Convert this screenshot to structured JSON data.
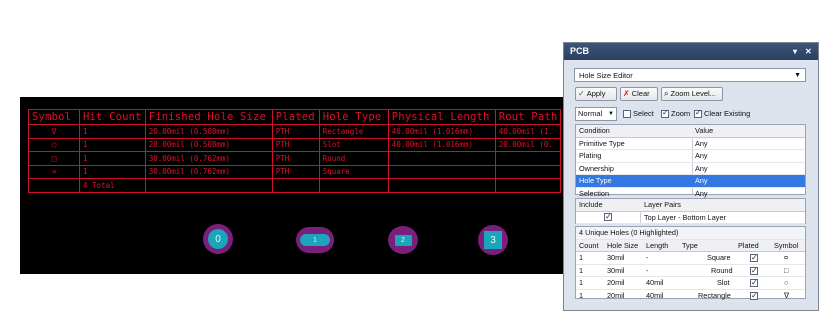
{
  "drill_table": {
    "headers": [
      "Symbol",
      "Hit Count",
      "Finished Hole Size",
      "Plated",
      "Hole Type",
      "Physical Length",
      "Rout Path"
    ],
    "rows": [
      {
        "symbol": "∇",
        "hits": "1",
        "size": "20.00mil (0.508mm)",
        "plated": "PTH",
        "type": "Rectangle",
        "length": "40.00mil (1.016mm)",
        "rout": "40.00mil (1."
      },
      {
        "symbol": "○",
        "hits": "1",
        "size": "20.00mil (0.508mm)",
        "plated": "PTH",
        "type": "Slot",
        "length": "40.00mil (1.016mm)",
        "rout": "20.00mil (0."
      },
      {
        "symbol": "□",
        "hits": "1",
        "size": "30.00mil (0.762mm)",
        "plated": "PTH",
        "type": "Round",
        "length": "",
        "rout": ""
      },
      {
        "symbol": "¤",
        "hits": "1",
        "size": "30.00mil (0.762mm)",
        "plated": "PTH",
        "type": "Square",
        "length": "",
        "rout": ""
      }
    ],
    "total": "4 Total"
  },
  "pads": [
    "0",
    "1",
    "2",
    "3"
  ],
  "panel": {
    "title": "PCB",
    "title_buttons": [
      "▾",
      "✕"
    ],
    "editor": "Hole Size Editor",
    "apply": "Apply",
    "clear": "Clear",
    "zoom_level": "Zoom Level...",
    "mode": "Normal",
    "select": "Select",
    "zoom": "Zoom",
    "clear_existing": "Clear Existing",
    "filter_headers": [
      "Condition",
      "Value"
    ],
    "filters": [
      [
        "Primitive Type",
        "Any"
      ],
      [
        "Plating",
        "Any"
      ],
      [
        "Ownership",
        "Any"
      ],
      [
        "Hole Type",
        "Any"
      ],
      [
        "Selection",
        "Any"
      ]
    ],
    "selected_filter": 3,
    "layer_headers": [
      "Include",
      "Layer Pairs"
    ],
    "layer_pair": "Top Layer - Bottom Layer",
    "holes_summary": "4 Unique Holes (0 Highlighted)",
    "hole_headers": [
      "Count",
      "Hole Size",
      "Length",
      "Type",
      "Plated",
      "Symbol"
    ],
    "holes": [
      {
        "count": "1",
        "size": "30mil",
        "length": "-",
        "type": "Square",
        "symbol": "¤"
      },
      {
        "count": "1",
        "size": "30mil",
        "length": "-",
        "type": "Round",
        "symbol": "□"
      },
      {
        "count": "1",
        "size": "20mil",
        "length": "40mil",
        "type": "Slot",
        "symbol": "○"
      },
      {
        "count": "1",
        "size": "20mil",
        "length": "40mil",
        "type": "Rectangle",
        "symbol": "∇"
      }
    ],
    "colors": {
      "title_bar": "#2b4061",
      "selection": "#3478e2",
      "drill_table": "#e0102a",
      "pad": "#1aa5b8",
      "pad_ring": "#7a1f7c"
    }
  }
}
